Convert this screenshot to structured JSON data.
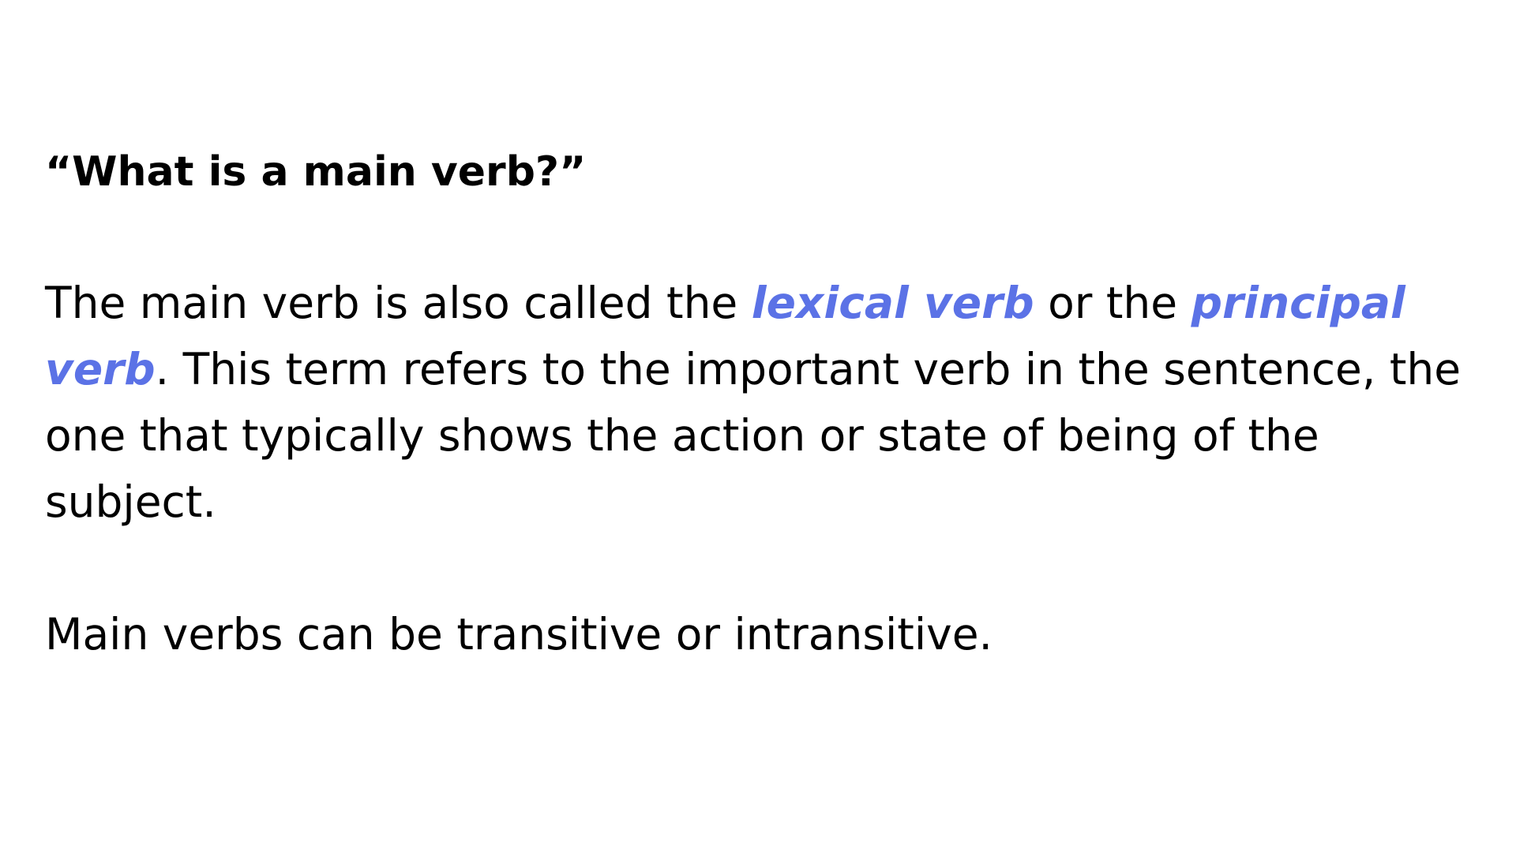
{
  "heading": "“What is a main verb?”",
  "paragraph_1": {
    "part_1": "The main verb is also called the ",
    "term_1": "lexical verb",
    "part_2": " or the ",
    "term_2": "principal verb",
    "part_3": ". This term refers to the important verb in the sentence, the one that typically shows the action or state of being of the subject."
  },
  "paragraph_2": "Main verbs can be transitive or intransitive.",
  "colors": {
    "term_highlight": "#5b72e6",
    "text": "#000000",
    "background": "#ffffff"
  }
}
